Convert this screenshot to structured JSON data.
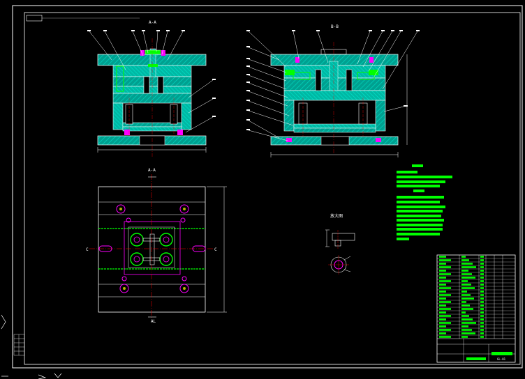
{
  "views": {
    "view1_label": "A-A",
    "view2_label": "B-B",
    "plan_label": "A-A",
    "left_mark": "C",
    "right_mark": "C",
    "bottom_mark": "AL",
    "detail_label": "放大图"
  },
  "colors": {
    "background": "#000000",
    "outline": "#ffffff",
    "plate_fill": "#00aa9e",
    "hatch": "#00c8b4",
    "green": "#00ff00",
    "red": "#ff0000",
    "magenta": "#ff00ff",
    "yellow": "#ffff00",
    "cyan": "#00ffff"
  },
  "title_block": {
    "drawing_no": "GL-01"
  }
}
